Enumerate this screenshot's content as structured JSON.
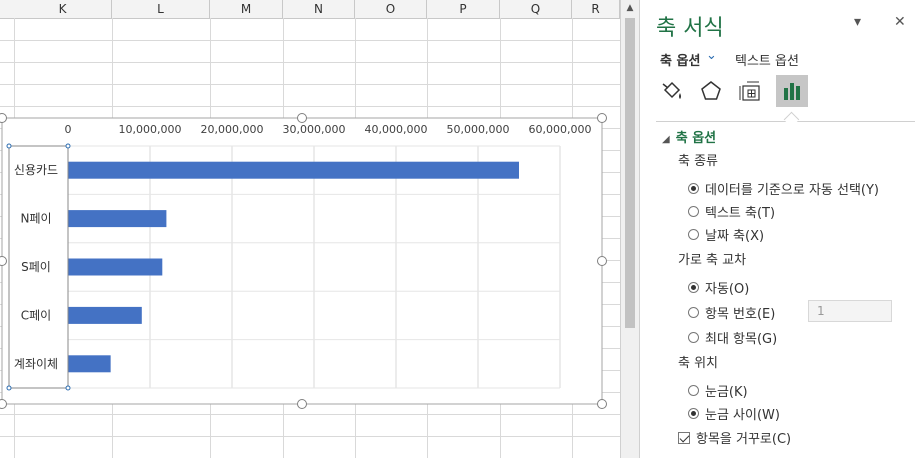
{
  "sheet": {
    "columns": [
      "K",
      "L",
      "M",
      "N",
      "O",
      "P",
      "Q",
      "R"
    ]
  },
  "chart_data": {
    "type": "bar",
    "orientation": "horizontal",
    "categories": [
      "신용카드",
      "N페이",
      "S페이",
      "C페이",
      "계좌이체"
    ],
    "values": [
      55000000,
      12000000,
      11500000,
      9000000,
      5200000
    ],
    "x_ticks": [
      "0",
      "10,000,000",
      "20,000,000",
      "30,000,000",
      "40,000,000",
      "50,000,000",
      "60,000,000"
    ],
    "xlim": [
      0,
      60000000
    ],
    "axis_position": "top",
    "bar_color": "#4472c4",
    "grid": true
  },
  "panel": {
    "title": "축 서식",
    "dropdown_icon": "triangle-down-icon",
    "close_label": "✕",
    "tabs": {
      "axis_options": "축 옵션",
      "text_options": "텍스트 옵션"
    },
    "section_title": "축 옵션",
    "axis_type": {
      "label": "축 종류",
      "options": [
        "데이터를 기준으로 자동 선택(Y)",
        "텍스트 축(T)",
        "날짜 축(X)"
      ],
      "selected": 0
    },
    "crosses": {
      "label": "가로 축 교차",
      "options": [
        "자동(O)",
        "항목 번호(E)",
        "최대 항목(G)"
      ],
      "selected": 0,
      "number_value": "1"
    },
    "axis_position": {
      "label": "축 위치",
      "options": [
        "눈금(K)",
        "눈금 사이(W)"
      ],
      "selected": 1
    },
    "reverse": {
      "label": "항목을 거꾸로(C)",
      "checked": true
    },
    "accent": "#217346"
  }
}
